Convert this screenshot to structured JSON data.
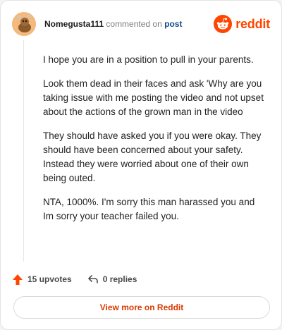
{
  "header": {
    "username": "Nomegusta111",
    "verb": "commented on",
    "link": "post",
    "brand": "reddit"
  },
  "comment": {
    "paragraphs": [
      "I hope you are in a position to pull in your parents.",
      "Look them dead in their faces and ask 'Why are you taking issue with me posting the video and not upset about the actions of the grown man in the video",
      "They should have asked you if you were okay. They should have been concerned about your safety. Instead they were worried about one of their own being outed.",
      "NTA, 1000%. I'm sorry this man harassed you and Im sorry your teacher failed you."
    ]
  },
  "actions": {
    "upvotes": "15 upvotes",
    "replies": "0 replies"
  },
  "footer": {
    "view_more": "View more on Reddit"
  },
  "colors": {
    "brand": "#ff4500",
    "view_more_text": "#d93900",
    "link": "#0f4a8a"
  },
  "icons": {
    "avatar": "avatar-icon",
    "brand_logo": "reddit-logo-icon",
    "upvote": "upvote-arrow-icon",
    "reply": "reply-arrow-icon"
  }
}
